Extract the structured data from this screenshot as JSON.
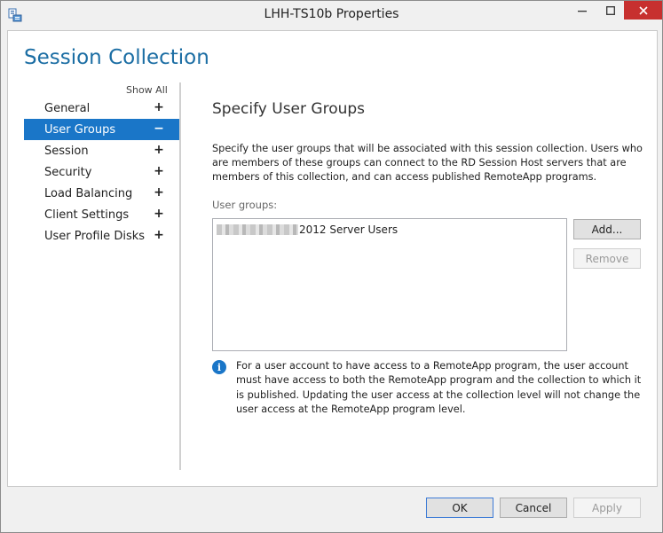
{
  "window": {
    "title": "LHH-TS10b Properties",
    "icons": {
      "app": "server-properties-icon",
      "minimize": "minimize-icon",
      "maximize": "maximize-icon",
      "close": "close-icon"
    }
  },
  "heading": "Session Collection",
  "nav": {
    "show_all": "Show All",
    "items": [
      {
        "label": "General",
        "sign": "+"
      },
      {
        "label": "User Groups",
        "sign": "−",
        "selected": true
      },
      {
        "label": "Session",
        "sign": "+"
      },
      {
        "label": "Security",
        "sign": "+"
      },
      {
        "label": "Load Balancing",
        "sign": "+"
      },
      {
        "label": "Client Settings",
        "sign": "+"
      },
      {
        "label": "User Profile Disks",
        "sign": "+"
      }
    ]
  },
  "content": {
    "section_title": "Specify User Groups",
    "description": "Specify the user groups that will be associated with this session collection. Users who are members of these groups can connect to the RD Session Host servers that are members of this collection, and can access published RemoteApp programs.",
    "user_groups_label": "User groups:",
    "user_groups": [
      {
        "visible_name": "2012 Server Users"
      }
    ],
    "add_button": "Add...",
    "remove_button": "Remove",
    "info_text": "For a user account to have access to a RemoteApp program, the user account must have access to both the RemoteApp program and the collection to which it is published. Updating the user access at the collection level will not change the user access at the RemoteApp program level."
  },
  "footer": {
    "ok": "OK",
    "cancel": "Cancel",
    "apply": "Apply"
  },
  "colors": {
    "accent": "#1a76c8",
    "heading": "#1c6ea4",
    "close": "#c7302f"
  }
}
